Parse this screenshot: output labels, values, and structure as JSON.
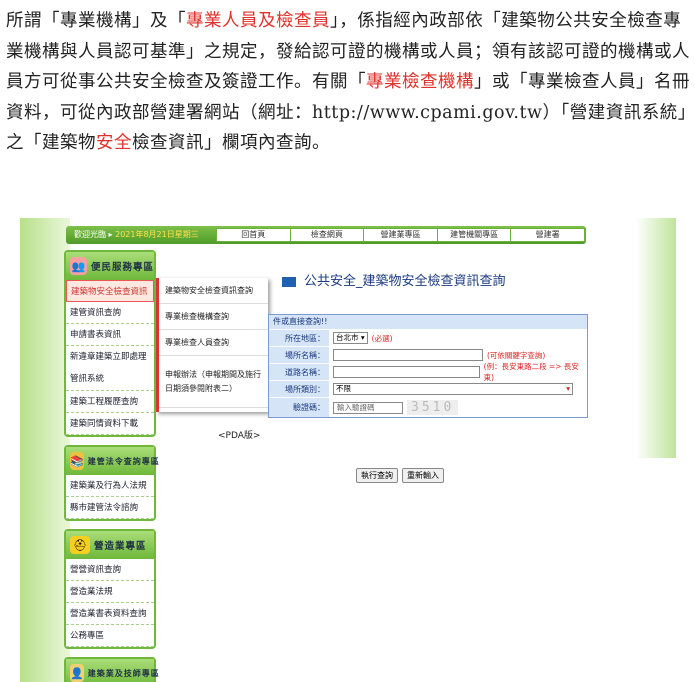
{
  "paragraph": {
    "p1": "所謂「專業機構」及「",
    "p1_red": "專業人員及檢查員",
    "p2": "」，係指經內政部依「建築物公共安全檢查專業機構與人員認可基準」之規定，發給認可證的機構或人員；領有該認可證的機構或人員方可從事公共安全檢查及簽證工作。有關「",
    "p2_red": "專業檢查機構",
    "p3": "」或「專業檢查人員」名冊資料，可從內政部營建署網站（網址：http://www.cpami.gov.tw）「營建資訊系統」之「建築物",
    "p3_red": "安全",
    "p4": "檢查資訊」欄項內查詢。"
  },
  "topbar": {
    "date_prefix": "歡迎光臨 ▸",
    "date": "2021年8月21日星期三",
    "nav": [
      "回首頁",
      "檢查網頁",
      "營建業專區",
      "建管機關專區",
      "營建署"
    ]
  },
  "sidebar": {
    "sections": [
      {
        "title": "便民服務專區",
        "icon": "people-icon",
        "items": [
          "建築物安全檢查資訊",
          "建管資訊查詢",
          "申請書表資訊",
          "新違章建築立即處理管訊系統",
          "建築工程履歷查詢",
          "建築同情資料下載"
        ]
      },
      {
        "title": "建管法令查詢專區",
        "icon": "book-icon",
        "items": [
          "建築業及行為人法規",
          "縣市建管法令諮詢"
        ]
      },
      {
        "title": "營造業專區",
        "icon": "helmet-icon",
        "items": [
          "營營資訊查詢",
          "營造業法規",
          "營造業書表資料查詢",
          "公務專區"
        ]
      },
      {
        "title": "建築業及技師專區",
        "icon": "person-icon",
        "items": []
      }
    ]
  },
  "flyout": {
    "items": [
      "建築物安全檢查資訊查詢",
      "專業檢查機構查詢",
      "專業檢查人員查詢",
      "申報辦法（申報期間及施行日期須參閱附表二）"
    ]
  },
  "main": {
    "title": "公共安全_建築物安全檢查資訊查詢",
    "form_head": "件或直接查詢!!",
    "rows": [
      {
        "label": "所在地區：",
        "select": "台北市",
        "note": "(必選)"
      },
      {
        "label": "場所名稱：",
        "note": "(可依關鍵字查詢)"
      },
      {
        "label": "道路名稱：",
        "note": "(例：長安東路二段 => 長安東)"
      },
      {
        "label": "場所類別：",
        "select": "不限"
      },
      {
        "label": "驗證碼：",
        "placeholder": "輸入驗證碼",
        "captcha": "3510"
      }
    ],
    "pda": "<PDA版>",
    "search_btn": "執行查詢",
    "reset_btn": "重新輸入"
  }
}
